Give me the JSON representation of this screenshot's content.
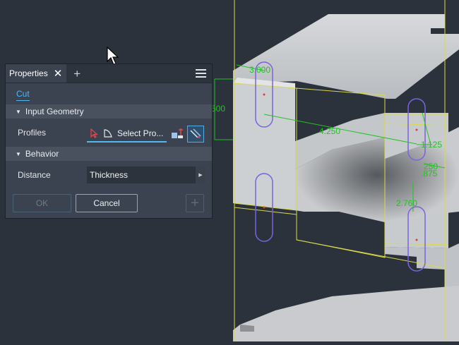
{
  "panel": {
    "tab_title": "Properties",
    "close_glyph": "✕",
    "add_glyph": "+",
    "command_link": "Cut",
    "sections": {
      "input_geometry": "Input Geometry",
      "behavior": "Behavior"
    },
    "profiles": {
      "label": "Profiles",
      "select_text": "Select Pro..."
    },
    "distance": {
      "label": "Distance",
      "value": "Thickness"
    },
    "buttons": {
      "ok": "OK",
      "cancel": "Cancel",
      "add": "+"
    },
    "colors": {
      "accent": "#4fb7f2",
      "panel_bg": "#3b4350"
    },
    "icons": [
      "close-icon",
      "plus-icon",
      "hamburger-menu-icon",
      "select-arrow-icon",
      "face-icon",
      "solids-icon",
      "direction-icon",
      "caret-right-icon"
    ]
  },
  "viewport": {
    "dimensions": {
      "d1": "3.000",
      "d2": "500",
      "d3": "4.250",
      "d4": "1.125",
      "d5": "250",
      "d6": ".875",
      "d7": "2.760"
    },
    "colors": {
      "background": "#2b323c",
      "dimension": "#22c322",
      "edges_highlight": "#d9d94a",
      "sketch": "#7a63e0"
    }
  }
}
